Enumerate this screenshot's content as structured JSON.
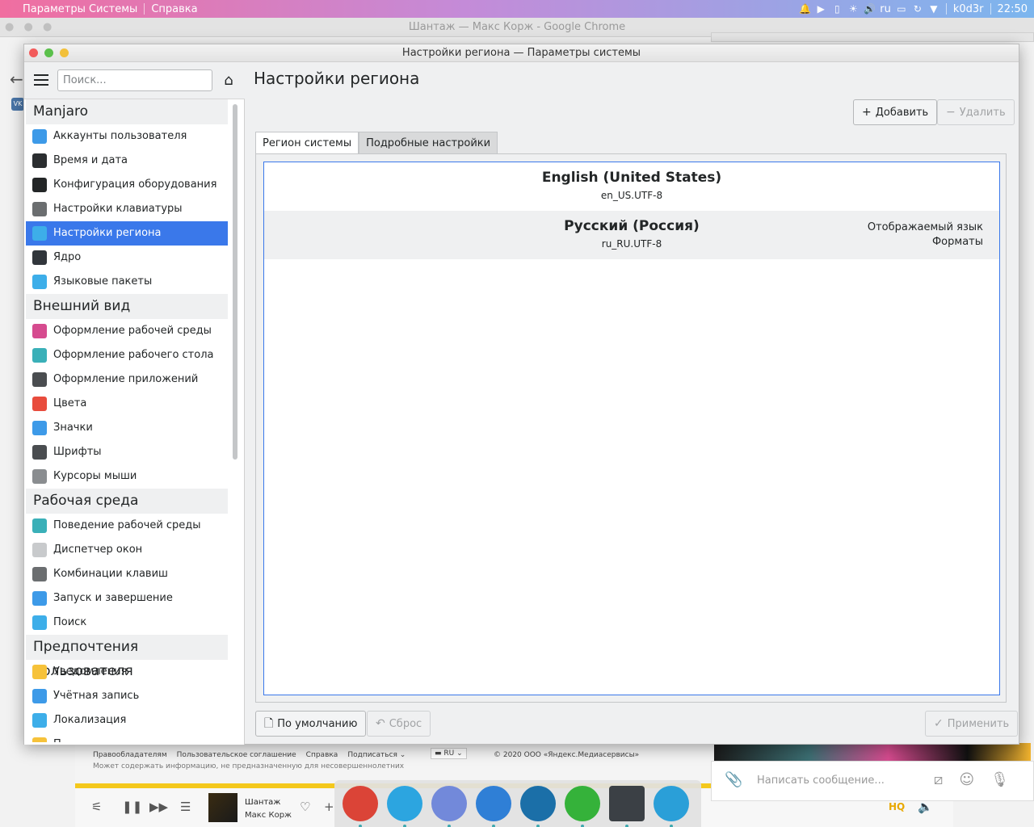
{
  "top_panel": {
    "app_menu": "Параметры Системы",
    "help_menu": "Справка",
    "language": "ru",
    "user": "k0d3r",
    "clock": "22:50"
  },
  "background": {
    "chrome_title": "Шантаж — Макс Корж - Google Chrome",
    "vk_label": "VK",
    "footer_links": [
      "Правообладателям",
      "Пользовательское соглашение",
      "Справка",
      "Подписаться ⌄"
    ],
    "footer_note": "Может содержать информацию, не предназначенную для несовершеннолетних",
    "footer_lang": "RU",
    "footer_copy": "© 2020 ООО «Яндекс.Медиасервисы»",
    "player_track": "Шантаж",
    "player_artist": "Макс Корж",
    "player_quality": "HQ",
    "telegram_placeholder": "Написать сообщение..."
  },
  "window": {
    "title": "Настройки региона — Параметры системы"
  },
  "sidebar": {
    "search_placeholder": "Поиск...",
    "categories": [
      {
        "title": "Manjaro",
        "items": [
          {
            "label": "Аккаунты пользователя",
            "icon": "user-accounts-icon",
            "color": "#3d9ae8"
          },
          {
            "label": "Время и дата",
            "icon": "clock-icon",
            "color": "#2b2e30"
          },
          {
            "label": "Конфигурация оборудования",
            "icon": "hardware-icon",
            "color": "#232627"
          },
          {
            "label": "Настройки клавиатуры",
            "icon": "keyboard-icon",
            "color": "#6b6e70"
          },
          {
            "label": "Настройки региона",
            "icon": "region-icon",
            "color": "#3daee9"
          },
          {
            "label": "Ядро",
            "icon": "kernel-icon",
            "color": "#31363b"
          },
          {
            "label": "Языковые пакеты",
            "icon": "language-packs-icon",
            "color": "#3daee9"
          }
        ]
      },
      {
        "title": "Внешний вид",
        "items": [
          {
            "label": "Оформление рабочей среды",
            "icon": "workspace-theme-icon",
            "color": "#d64b8f"
          },
          {
            "label": "Оформление рабочего стола",
            "icon": "desktop-theme-icon",
            "color": "#3ab0b8"
          },
          {
            "label": "Оформление приложений",
            "icon": "app-style-icon",
            "color": "#4a4d50"
          },
          {
            "label": "Цвета",
            "icon": "colors-icon",
            "color": "#e84c3d"
          },
          {
            "label": "Значки",
            "icon": "icons-icon",
            "color": "#3d9ae8"
          },
          {
            "label": "Шрифты",
            "icon": "fonts-icon",
            "color": "#4a4d50"
          },
          {
            "label": "Курсоры мыши",
            "icon": "cursor-icon",
            "color": "#8a8d90"
          }
        ]
      },
      {
        "title": "Рабочая среда",
        "items": [
          {
            "label": "Поведение рабочей среды",
            "icon": "workspace-behavior-icon",
            "color": "#3ab0b8"
          },
          {
            "label": "Диспетчер окон",
            "icon": "window-manager-icon",
            "color": "#c8cacc"
          },
          {
            "label": "Комбинации клавиш",
            "icon": "shortcuts-icon",
            "color": "#6b6e70"
          },
          {
            "label": "Запуск и завершение",
            "icon": "startup-icon",
            "color": "#3d9ae8"
          },
          {
            "label": "Поиск",
            "icon": "search-settings-icon",
            "color": "#3daee9"
          }
        ]
      },
      {
        "title": "Предпочтения пользователя",
        "items": [
          {
            "label": "Уведомления",
            "icon": "bell-icon",
            "color": "#f6c23a"
          },
          {
            "label": "Учётная запись",
            "icon": "account-icon",
            "color": "#3d9ae8"
          },
          {
            "label": "Локализация",
            "icon": "localization-icon",
            "color": "#3daee9"
          },
          {
            "label": "П...",
            "icon": "partial-item-icon",
            "color": "#f6c23a"
          }
        ]
      }
    ],
    "selected": "Настройки региона"
  },
  "main": {
    "title": "Настройки региона",
    "add_label": "Добавить",
    "remove_label": "Удалить",
    "tabs": [
      {
        "label": "Регион системы",
        "active": true
      },
      {
        "label": "Подробные настройки",
        "active": false
      }
    ],
    "locales": [
      {
        "name": "English (United States)",
        "code": "en_US.UTF-8",
        "tags": []
      },
      {
        "name": "Русский (Россия)",
        "code": "ru_RU.UTF-8",
        "tags": [
          "Отображаемый язык",
          "Форматы"
        ]
      }
    ],
    "defaults_label": "По умолчанию",
    "reset_label": "Сброс",
    "apply_label": "Применить"
  },
  "dock": {
    "apps": [
      {
        "name": "chrome-icon",
        "color": "#db4437",
        "active": false
      },
      {
        "name": "telegram-icon",
        "color": "#2ca5e0",
        "active": false
      },
      {
        "name": "discord-icon",
        "color": "#7289da",
        "active": false
      },
      {
        "name": "files-icon",
        "color": "#2f7fd6",
        "active": false
      },
      {
        "name": "steam-icon",
        "color": "#1b6fa8",
        "active": false
      },
      {
        "name": "downloader-icon",
        "color": "#35b23a",
        "active": false
      },
      {
        "name": "system-settings-icon",
        "color": "#3b4045",
        "active": true
      },
      {
        "name": "app-store-icon",
        "color": "#2a9fd8",
        "active": false
      }
    ]
  }
}
